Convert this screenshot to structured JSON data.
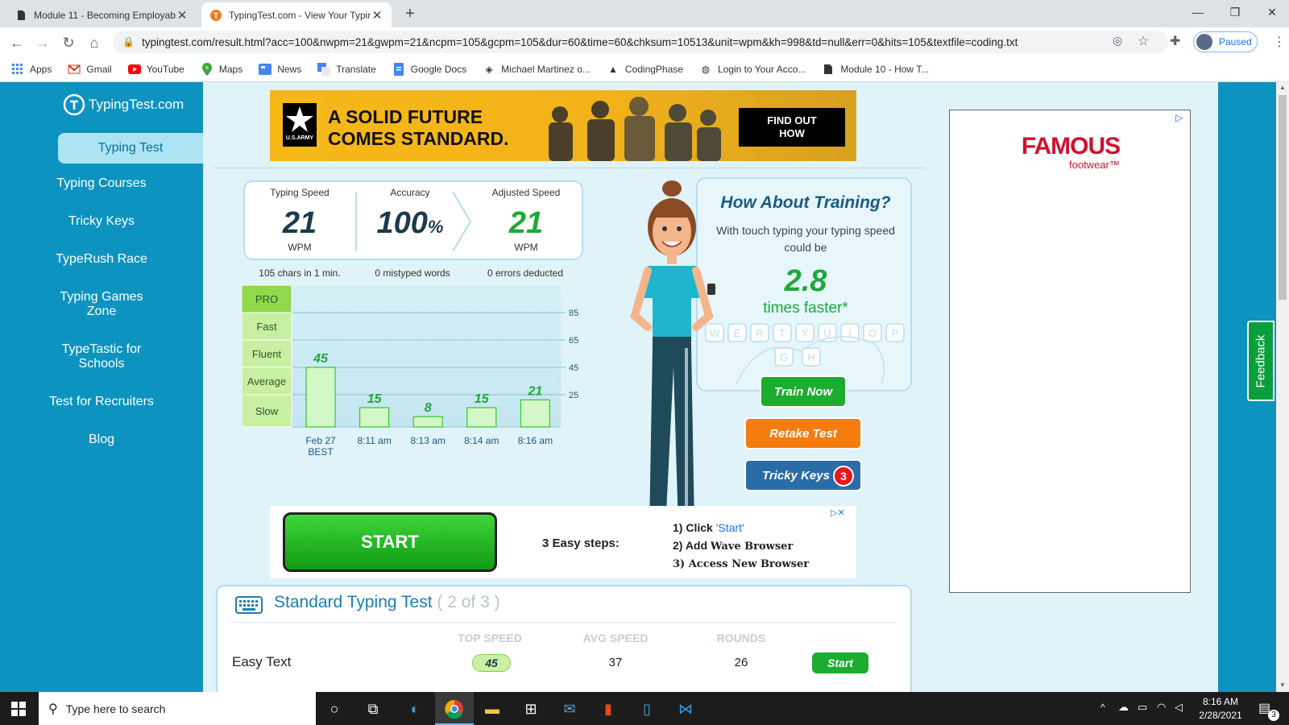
{
  "browser": {
    "tabs": [
      {
        "title": "Module 11 - Becoming Employab",
        "active": false
      },
      {
        "title": "TypingTest.com - View Your Typin",
        "active": true
      }
    ],
    "url": "typingtest.com/result.html?acc=100&nwpm=21&gwpm=21&ncpm=105&gcpm=105&dur=60&time=60&chksum=10513&unit=wpm&kh=998&td=null&err=0&hits=105&textfile=coding.txt",
    "profile_label": "Paused",
    "bookmarks": [
      "Apps",
      "Gmail",
      "YouTube",
      "Maps",
      "News",
      "Translate",
      "Google Docs",
      "Michael Martinez o...",
      "CodingPhase",
      "Login to Your Acco...",
      "Module 10 - How T..."
    ]
  },
  "site": {
    "logo": "TypingTest.com",
    "nav": [
      "Typing Test",
      "Typing Courses",
      "Tricky Keys",
      "TypeRush Race",
      "Typing Games Zone",
      "TypeTastic for Schools",
      "Test for Recruiters",
      "Blog"
    ],
    "feedback_label": "Feedback"
  },
  "ads": {
    "army_headline_1": "A SOLID FUTURE",
    "army_headline_2": "COMES STANDARD.",
    "army_badge": "U.S.ARMY",
    "army_cta": "FIND OUT HOW",
    "famous_brand": "FAMOUS",
    "famous_sub": "footwear™",
    "start_label": "START",
    "steps_title": "3 Easy steps:",
    "step1_prefix": "1) Click ",
    "step1_link": "'Start'",
    "step2_prefix": "2) Add ",
    "step2_bold": "Wave Browser",
    "step3": "3) Access New Browser"
  },
  "results": {
    "typing_speed_label": "Typing Speed",
    "typing_speed_value": "21",
    "typing_speed_unit": "WPM",
    "accuracy_label": "Accuracy",
    "accuracy_value": "100",
    "accuracy_unit": "%",
    "adjusted_label": "Adjusted Speed",
    "adjusted_value": "21",
    "adjusted_unit": "WPM",
    "sub_chars": "105 chars in 1 min.",
    "sub_mistyped": "0 mistyped words",
    "sub_errors": "0 errors deducted"
  },
  "chart_data": {
    "type": "bar",
    "levels": [
      "PRO",
      "Fast",
      "Fluent",
      "Average",
      "Slow"
    ],
    "level_thresholds": [
      85,
      65,
      45,
      25
    ],
    "categories": [
      "Feb 27",
      "8:11 am",
      "8:13 am",
      "8:14 am",
      "8:16 am"
    ],
    "sublabels": [
      "BEST",
      "",
      "",
      "",
      ""
    ],
    "values": [
      45,
      15,
      8,
      15,
      21
    ],
    "ylim": [
      0,
      100
    ],
    "colors": {
      "bar": "#d3f7c6",
      "bar_border": "#36c82a",
      "level_bg": "#c9efa3",
      "level_top": "#8fd94a"
    }
  },
  "training": {
    "title": "How About Training?",
    "text": "With touch typing your typing speed could be",
    "multiplier": "2.8",
    "times": "times faster*",
    "keys": [
      "W",
      "E",
      "R",
      "T",
      "Y",
      "U",
      "I",
      "O",
      "P",
      "G",
      "H"
    ],
    "train_now": "Train Now",
    "retake": "Retake Test",
    "tricky_keys": "Tricky Keys",
    "tricky_count": "3"
  },
  "standard_test": {
    "title": "Standard Typing Test",
    "progress": "( 2 of 3 )",
    "col_top": "TOP SPEED",
    "col_avg": "AVG SPEED",
    "col_rounds": "ROUNDS",
    "row_name": "Easy Text",
    "row_top": "45",
    "row_avg": "37",
    "row_rounds": "26",
    "row_start": "Start"
  },
  "taskbar": {
    "search_placeholder": "Type here to search",
    "time": "8:16 AM",
    "date": "2/28/2021",
    "notification_count": "3"
  }
}
